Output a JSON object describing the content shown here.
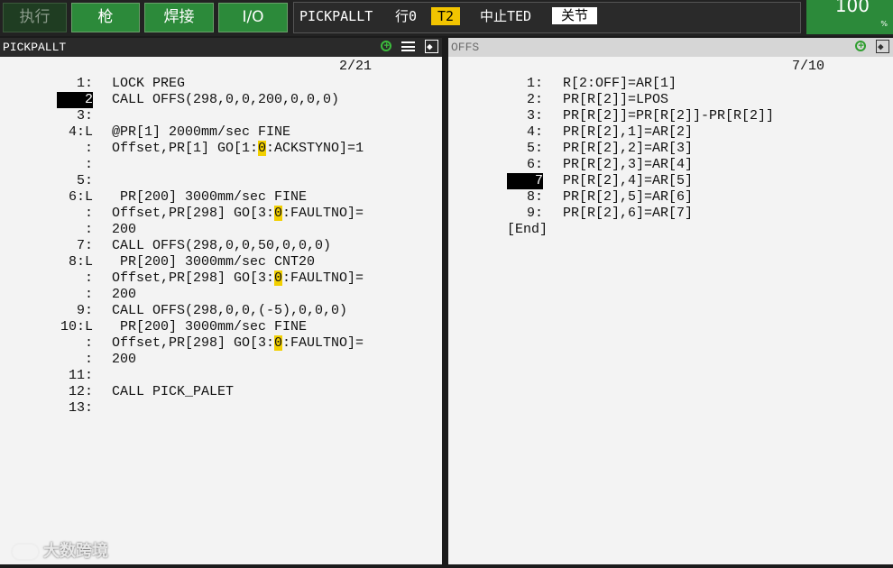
{
  "topbar": {
    "buttons": [
      "执行",
      "枪",
      "焊接",
      "I/O"
    ],
    "program_name": "PICKPALLT",
    "line_label": "行0",
    "mode_badge": "T2",
    "status_text": "中止TED",
    "hold_badge": "关节",
    "override_value": "100",
    "override_unit": "%"
  },
  "left_pane": {
    "title": "PICKPALLT",
    "position": "2/21",
    "lines": [
      {
        "num": "1:",
        "text": "LOCK PREG"
      },
      {
        "num": "2",
        "text": "CALL OFFS(298,0,0,200,0,0,0)",
        "cursor": true
      },
      {
        "num": "3:",
        "text": ""
      },
      {
        "num": "4:L",
        "text": "@PR[1] 2000mm/sec FINE"
      },
      {
        "num": ":",
        "pre": "Offset,PR[1] GO[1:",
        "hl": "0",
        "post": ":ACKSTYNO]=1"
      },
      {
        "num": ":",
        "text": ""
      },
      {
        "num": "5:",
        "text": ""
      },
      {
        "num": "6:L",
        "text": " PR[200] 3000mm/sec FINE"
      },
      {
        "num": ":",
        "pre": "Offset,PR[298] GO[3:",
        "hl": "0",
        "post": ":FAULTNO]="
      },
      {
        "num": ":",
        "text": "200"
      },
      {
        "num": "7:",
        "text": "CALL OFFS(298,0,0,50,0,0,0)"
      },
      {
        "num": "8:L",
        "text": " PR[200] 3000mm/sec CNT20"
      },
      {
        "num": ":",
        "pre": "Offset,PR[298] GO[3:",
        "hl": "0",
        "post": ":FAULTNO]="
      },
      {
        "num": ":",
        "text": "200"
      },
      {
        "num": "9:",
        "text": "CALL OFFS(298,0,0,(-5),0,0,0)"
      },
      {
        "num": "10:L",
        "text": " PR[200] 3000mm/sec FINE"
      },
      {
        "num": ":",
        "pre": "Offset,PR[298] GO[3:",
        "hl": "0",
        "post": ":FAULTNO]="
      },
      {
        "num": ":",
        "text": "200"
      },
      {
        "num": "11:",
        "text": ""
      },
      {
        "num": "12:",
        "text": "CALL PICK_PALET"
      },
      {
        "num": "13:",
        "text": ""
      }
    ]
  },
  "right_pane": {
    "title": "OFFS",
    "position": "7/10",
    "lines": [
      {
        "num": "1:",
        "text": "R[2:OFF]=AR[1]"
      },
      {
        "num": "2:",
        "text": "PR[R[2]]=LPOS"
      },
      {
        "num": "3:",
        "text": "PR[R[2]]=PR[R[2]]-PR[R[2]]"
      },
      {
        "num": "4:",
        "text": "PR[R[2],1]=AR[2]"
      },
      {
        "num": "5:",
        "text": "PR[R[2],2]=AR[3]"
      },
      {
        "num": "6:",
        "text": "PR[R[2],3]=AR[4]"
      },
      {
        "num": "7",
        "text": "PR[R[2],4]=AR[5]",
        "cursor": true
      },
      {
        "num": "8:",
        "text": "PR[R[2],5]=AR[6]"
      },
      {
        "num": "9:",
        "text": "PR[R[2],6]=AR[7]"
      },
      {
        "num": "[End]",
        "text": "",
        "end": true
      }
    ]
  },
  "watermark": "大数跨境",
  "colors": {
    "accent_green": "#2c8a3a",
    "badge_yellow": "#f2c400",
    "highlight": "#f2d000"
  }
}
